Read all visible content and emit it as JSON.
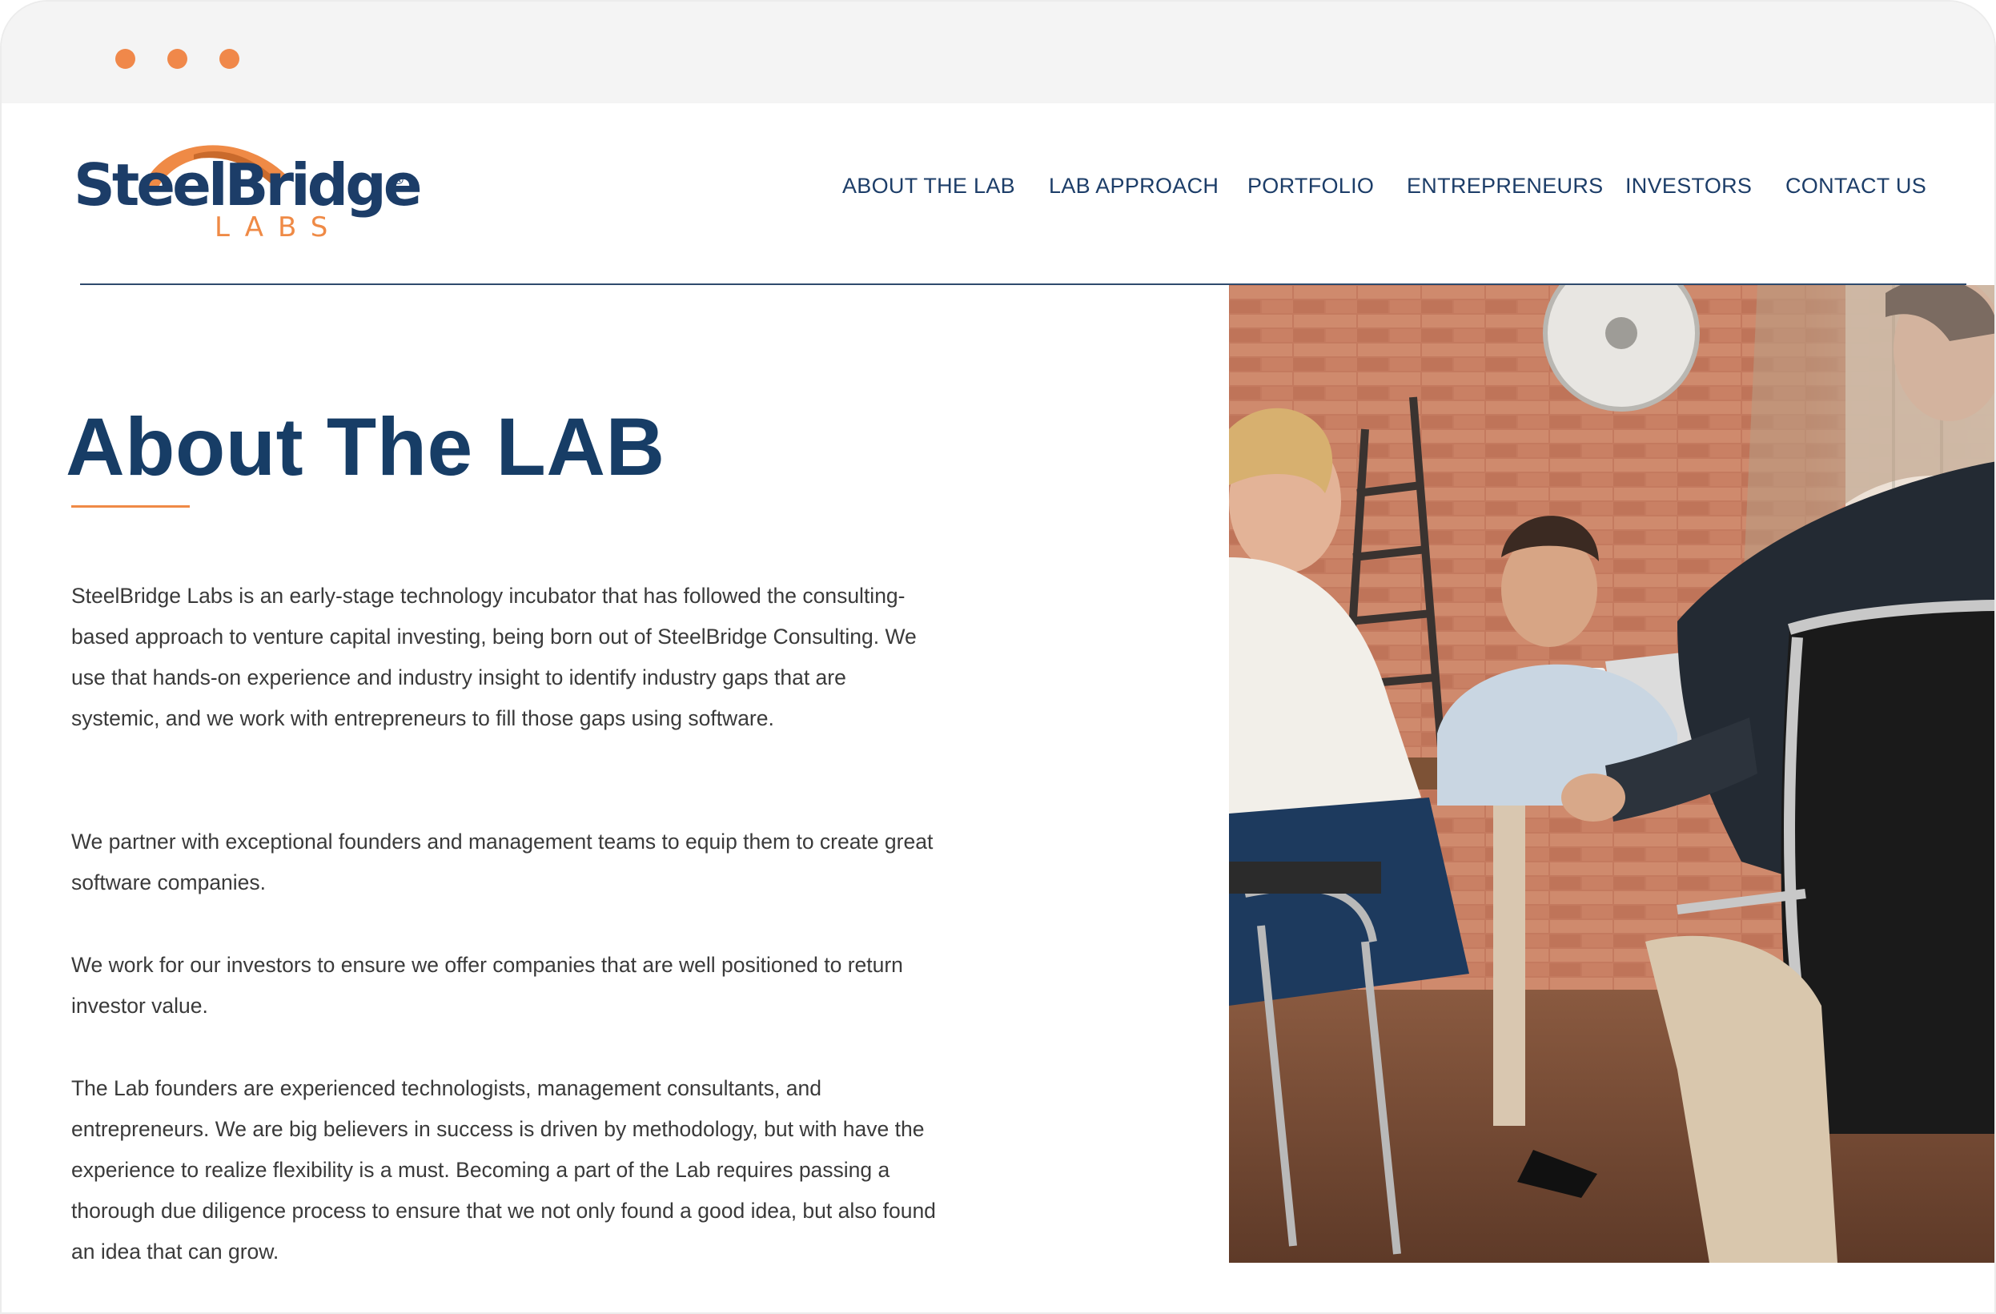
{
  "window": {
    "controls": [
      "close",
      "minimize",
      "maximize"
    ],
    "dot_color": "#f0884a"
  },
  "header": {
    "logo": {
      "wordmark": "SteelBridge",
      "registered": "®",
      "sub": "LABS"
    },
    "nav": [
      {
        "label": "ABOUT THE LAB"
      },
      {
        "label": "LAB APPROACH"
      },
      {
        "label": "PORTFOLIO"
      },
      {
        "label": "ENTREPRENEURS"
      },
      {
        "label": "INVESTORS"
      },
      {
        "label": "CONTACT US"
      }
    ]
  },
  "main": {
    "title": "About The LAB",
    "paragraphs": [
      "SteelBridge Labs is an early-stage technology incubator that has followed the consulting-based approach to venture capital investing, being born out of SteelBridge Consulting. We use that hands-on experience and industry insight to identify industry gaps that are systemic, and we work with entrepreneurs to fill those gaps using software.",
      "We partner with exceptional founders and management teams to equip them to create great software companies.",
      "We work for our investors to ensure we offer companies that are well positioned to return investor value.",
      "The Lab founders are experienced technologists, management consultants, and entrepreneurs. We are big believers in success is driven by methodology, but with have the experience to realize flexibility is a must. Becoming a part of the Lab requires passing a thorough due diligence process to ensure that we not only found a good idea, but also found an idea that can grow."
    ]
  },
  "colors": {
    "brand_navy": "#1c3d68",
    "brand_orange": "#ef8a46",
    "body_text": "#3a3a3a"
  }
}
